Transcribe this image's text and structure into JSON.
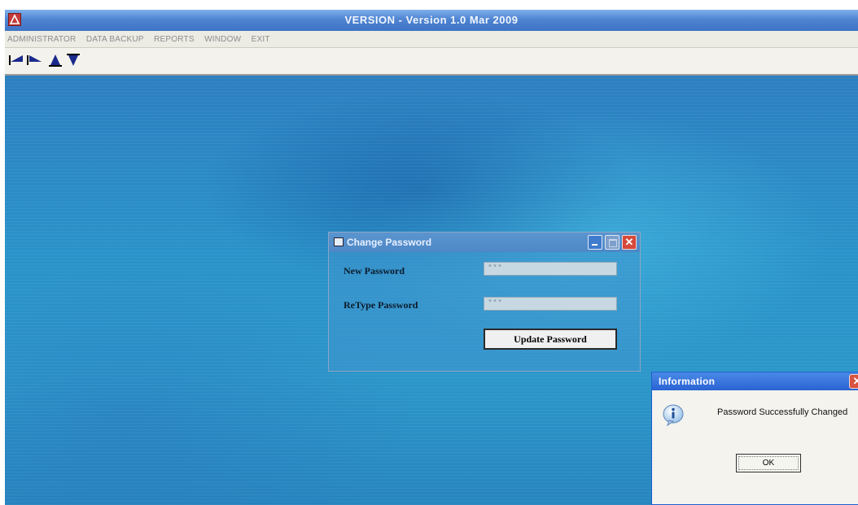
{
  "window": {
    "title": "VERSION  -  Version 1.0 Mar 2009",
    "icon": "app-logo-icon"
  },
  "menu": {
    "items": [
      "ADMINISTRATOR",
      "DATA BACKUP",
      "REPORTS",
      "WINDOW",
      "EXIT"
    ]
  },
  "toolbar": {
    "buttons": [
      "arrow-left-icon",
      "arrow-right-icon",
      "arrow-up-icon",
      "arrow-down-icon"
    ]
  },
  "change_password_dialog": {
    "title": "Change Password",
    "new_password_label": "New Password",
    "new_password_value": "***",
    "retype_password_label": "ReType Password",
    "retype_password_value": "***",
    "update_button": "Update Password",
    "close_glyph": "✕"
  },
  "info_dialog": {
    "title": "Information",
    "message": "Password Successfully Changed",
    "ok_button": "OK",
    "close_glyph": "✕"
  },
  "colors": {
    "desktop": "#2a86c0",
    "titlebar": "#4e84d2",
    "info_titlebar": "#2a63d3",
    "close_button": "#d6493a"
  }
}
